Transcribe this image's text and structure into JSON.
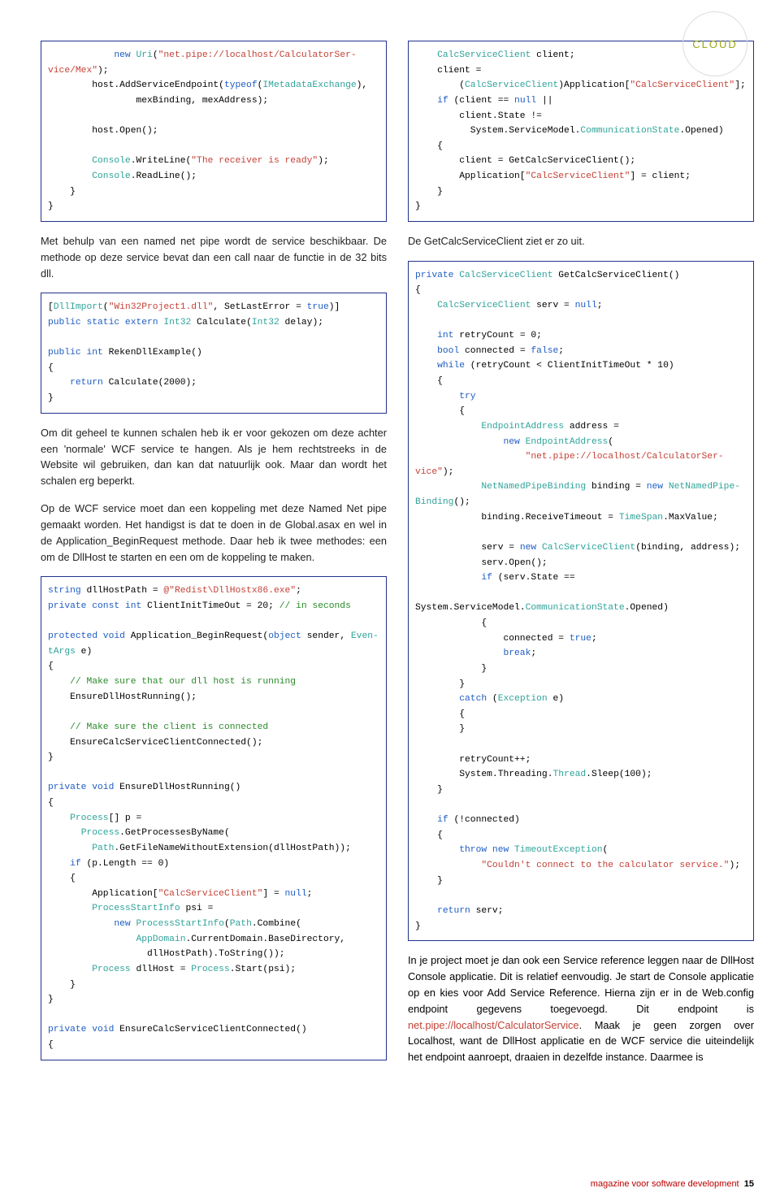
{
  "badge": "CLOUD",
  "left": {
    "code1": [
      {
        "t": "m",
        "v": "            "
      },
      {
        "t": "k",
        "v": "new"
      },
      {
        "t": "m",
        "v": " "
      },
      {
        "t": "t",
        "v": "Uri"
      },
      {
        "t": "m",
        "v": "("
      },
      {
        "t": "s",
        "v": "\"net.pipe://localhost/CalculatorSer-"
      },
      {
        "t": "br"
      },
      {
        "t": "s",
        "v": "vice/Mex\""
      },
      {
        "t": "m",
        "v": ");"
      },
      {
        "t": "br"
      },
      {
        "t": "m",
        "v": "        host.AddServiceEndpoint("
      },
      {
        "t": "k",
        "v": "typeof"
      },
      {
        "t": "m",
        "v": "("
      },
      {
        "t": "t",
        "v": "IMetadataExchange"
      },
      {
        "t": "m",
        "v": "),"
      },
      {
        "t": "br"
      },
      {
        "t": "m",
        "v": "                mexBinding, mexAddress);"
      },
      {
        "t": "br"
      },
      {
        "t": "br"
      },
      {
        "t": "m",
        "v": "        host.Open();"
      },
      {
        "t": "br"
      },
      {
        "t": "br"
      },
      {
        "t": "m",
        "v": "        "
      },
      {
        "t": "t",
        "v": "Console"
      },
      {
        "t": "m",
        "v": ".WriteLine("
      },
      {
        "t": "s",
        "v": "\"The receiver is ready\""
      },
      {
        "t": "m",
        "v": ");"
      },
      {
        "t": "br"
      },
      {
        "t": "m",
        "v": "        "
      },
      {
        "t": "t",
        "v": "Console"
      },
      {
        "t": "m",
        "v": ".ReadLine();"
      },
      {
        "t": "br"
      },
      {
        "t": "m",
        "v": "    }"
      },
      {
        "t": "br"
      },
      {
        "t": "m",
        "v": "}"
      }
    ],
    "para1": "Met behulp van een named net pipe wordt de service beschikbaar. De methode op deze service bevat dan een call naar de functie in de 32 bits dll.",
    "code2": [
      {
        "t": "m",
        "v": "["
      },
      {
        "t": "t",
        "v": "DllImport"
      },
      {
        "t": "m",
        "v": "("
      },
      {
        "t": "s",
        "v": "\"Win32Project1.dll\""
      },
      {
        "t": "m",
        "v": ", SetLastError = "
      },
      {
        "t": "k",
        "v": "true"
      },
      {
        "t": "m",
        "v": ")]"
      },
      {
        "t": "br"
      },
      {
        "t": "k",
        "v": "public static extern "
      },
      {
        "t": "t",
        "v": "Int32"
      },
      {
        "t": "m",
        "v": " Calculate("
      },
      {
        "t": "t",
        "v": "Int32"
      },
      {
        "t": "m",
        "v": " delay);"
      },
      {
        "t": "br"
      },
      {
        "t": "br"
      },
      {
        "t": "k",
        "v": "public "
      },
      {
        "t": "k",
        "v": "int"
      },
      {
        "t": "m",
        "v": " RekenDllExample()"
      },
      {
        "t": "br"
      },
      {
        "t": "m",
        "v": "{"
      },
      {
        "t": "br"
      },
      {
        "t": "m",
        "v": "    "
      },
      {
        "t": "k",
        "v": "return"
      },
      {
        "t": "m",
        "v": " Calculate(2000);"
      },
      {
        "t": "br"
      },
      {
        "t": "m",
        "v": "}"
      }
    ],
    "para2": "Om dit geheel te kunnen schalen heb ik er voor gekozen om deze achter een 'normale' WCF service te hangen. Als je hem rechtstreeks in de Website wil gebruiken, dan kan dat natuurlijk ook. Maar dan wordt het schalen erg beperkt.",
    "para3": "Op de WCF service moet dan een koppeling met deze Named Net pipe gemaakt worden. Het handigst is dat te doen in de Global.asax en wel in de Application_BeginRequest methode. Daar heb ik twee methodes: een om de DllHost te starten en een om de koppeling te maken.",
    "code3": [
      {
        "t": "k",
        "v": "string"
      },
      {
        "t": "m",
        "v": " dllHostPath = "
      },
      {
        "t": "s",
        "v": "@\"Redist\\DllHostx86.exe\""
      },
      {
        "t": "m",
        "v": ";"
      },
      {
        "t": "br"
      },
      {
        "t": "k",
        "v": "private const int"
      },
      {
        "t": "m",
        "v": " ClientInitTimeOut = 20; "
      },
      {
        "t": "c",
        "v": "// in seconds"
      },
      {
        "t": "br"
      },
      {
        "t": "br"
      },
      {
        "t": "k",
        "v": "protected void"
      },
      {
        "t": "m",
        "v": " Application_BeginRequest("
      },
      {
        "t": "k",
        "v": "object"
      },
      {
        "t": "m",
        "v": " sender, "
      },
      {
        "t": "t",
        "v": "Even-"
      },
      {
        "t": "br"
      },
      {
        "t": "t",
        "v": "tArgs"
      },
      {
        "t": "m",
        "v": " e)"
      },
      {
        "t": "br"
      },
      {
        "t": "m",
        "v": "{"
      },
      {
        "t": "br"
      },
      {
        "t": "m",
        "v": "    "
      },
      {
        "t": "c",
        "v": "// Make sure that our dll host is running"
      },
      {
        "t": "br"
      },
      {
        "t": "m",
        "v": "    EnsureDllHostRunning();"
      },
      {
        "t": "br"
      },
      {
        "t": "br"
      },
      {
        "t": "m",
        "v": "    "
      },
      {
        "t": "c",
        "v": "// Make sure the client is connected"
      },
      {
        "t": "br"
      },
      {
        "t": "m",
        "v": "    EnsureCalcServiceClientConnected();"
      },
      {
        "t": "br"
      },
      {
        "t": "m",
        "v": "}"
      },
      {
        "t": "br"
      },
      {
        "t": "br"
      },
      {
        "t": "k",
        "v": "private void"
      },
      {
        "t": "m",
        "v": " EnsureDllHostRunning()"
      },
      {
        "t": "br"
      },
      {
        "t": "m",
        "v": "{"
      },
      {
        "t": "br"
      },
      {
        "t": "m",
        "v": "    "
      },
      {
        "t": "t",
        "v": "Process"
      },
      {
        "t": "m",
        "v": "[] p ="
      },
      {
        "t": "br"
      },
      {
        "t": "m",
        "v": "      "
      },
      {
        "t": "t",
        "v": "Process"
      },
      {
        "t": "m",
        "v": ".GetProcessesByName("
      },
      {
        "t": "br"
      },
      {
        "t": "m",
        "v": "        "
      },
      {
        "t": "t",
        "v": "Path"
      },
      {
        "t": "m",
        "v": ".GetFileNameWithoutExtension(dllHostPath));"
      },
      {
        "t": "br"
      },
      {
        "t": "m",
        "v": "    "
      },
      {
        "t": "k",
        "v": "if"
      },
      {
        "t": "m",
        "v": " (p.Length == 0)"
      },
      {
        "t": "br"
      },
      {
        "t": "m",
        "v": "    {"
      },
      {
        "t": "br"
      },
      {
        "t": "m",
        "v": "        Application["
      },
      {
        "t": "s",
        "v": "\"CalcServiceClient\""
      },
      {
        "t": "m",
        "v": "] = "
      },
      {
        "t": "k",
        "v": "null"
      },
      {
        "t": "m",
        "v": ";"
      },
      {
        "t": "br"
      },
      {
        "t": "m",
        "v": "        "
      },
      {
        "t": "t",
        "v": "ProcessStartInfo"
      },
      {
        "t": "m",
        "v": " psi ="
      },
      {
        "t": "br"
      },
      {
        "t": "m",
        "v": "            "
      },
      {
        "t": "k",
        "v": "new"
      },
      {
        "t": "m",
        "v": " "
      },
      {
        "t": "t",
        "v": "ProcessStartInfo"
      },
      {
        "t": "m",
        "v": "("
      },
      {
        "t": "t",
        "v": "Path"
      },
      {
        "t": "m",
        "v": ".Combine("
      },
      {
        "t": "br"
      },
      {
        "t": "m",
        "v": "                "
      },
      {
        "t": "t",
        "v": "AppDomain"
      },
      {
        "t": "m",
        "v": ".CurrentDomain.BaseDirectory,"
      },
      {
        "t": "br"
      },
      {
        "t": "m",
        "v": "                  dllHostPath).ToString());"
      },
      {
        "t": "br"
      },
      {
        "t": "m",
        "v": "        "
      },
      {
        "t": "t",
        "v": "Process"
      },
      {
        "t": "m",
        "v": " dllHost = "
      },
      {
        "t": "t",
        "v": "Process"
      },
      {
        "t": "m",
        "v": ".Start(psi);"
      },
      {
        "t": "br"
      },
      {
        "t": "m",
        "v": "    }"
      },
      {
        "t": "br"
      },
      {
        "t": "m",
        "v": "}"
      },
      {
        "t": "br"
      },
      {
        "t": "br"
      },
      {
        "t": "k",
        "v": "private void"
      },
      {
        "t": "m",
        "v": " EnsureCalcServiceClientConnected()"
      },
      {
        "t": "br"
      },
      {
        "t": "m",
        "v": "{"
      }
    ]
  },
  "right": {
    "code1": [
      {
        "t": "m",
        "v": "    "
      },
      {
        "t": "t",
        "v": "CalcServiceClient"
      },
      {
        "t": "m",
        "v": " client;"
      },
      {
        "t": "br"
      },
      {
        "t": "m",
        "v": "    client ="
      },
      {
        "t": "br"
      },
      {
        "t": "m",
        "v": "        ("
      },
      {
        "t": "t",
        "v": "CalcServiceClient"
      },
      {
        "t": "m",
        "v": ")Application["
      },
      {
        "t": "s",
        "v": "\"CalcServiceClient\""
      },
      {
        "t": "m",
        "v": "];"
      },
      {
        "t": "br"
      },
      {
        "t": "m",
        "v": "    "
      },
      {
        "t": "k",
        "v": "if"
      },
      {
        "t": "m",
        "v": " (client == "
      },
      {
        "t": "k",
        "v": "null"
      },
      {
        "t": "m",
        "v": " ||"
      },
      {
        "t": "br"
      },
      {
        "t": "m",
        "v": "        client.State !="
      },
      {
        "t": "br"
      },
      {
        "t": "m",
        "v": "          System.ServiceModel."
      },
      {
        "t": "t",
        "v": "CommunicationState"
      },
      {
        "t": "m",
        "v": ".Opened)"
      },
      {
        "t": "br"
      },
      {
        "t": "m",
        "v": "    {"
      },
      {
        "t": "br"
      },
      {
        "t": "m",
        "v": "        client = GetCalcServiceClient();"
      },
      {
        "t": "br"
      },
      {
        "t": "m",
        "v": "        Application["
      },
      {
        "t": "s",
        "v": "\"CalcServiceClient\""
      },
      {
        "t": "m",
        "v": "] = client;"
      },
      {
        "t": "br"
      },
      {
        "t": "m",
        "v": "    }"
      },
      {
        "t": "br"
      },
      {
        "t": "m",
        "v": "}"
      }
    ],
    "para1": "De GetCalcServiceClient ziet er zo uit.",
    "code2": [
      {
        "t": "k",
        "v": "private "
      },
      {
        "t": "t",
        "v": "CalcServiceClient"
      },
      {
        "t": "m",
        "v": " GetCalcServiceClient()"
      },
      {
        "t": "br"
      },
      {
        "t": "m",
        "v": "{"
      },
      {
        "t": "br"
      },
      {
        "t": "m",
        "v": "    "
      },
      {
        "t": "t",
        "v": "CalcServiceClient"
      },
      {
        "t": "m",
        "v": " serv = "
      },
      {
        "t": "k",
        "v": "null"
      },
      {
        "t": "m",
        "v": ";"
      },
      {
        "t": "br"
      },
      {
        "t": "br"
      },
      {
        "t": "m",
        "v": "    "
      },
      {
        "t": "k",
        "v": "int"
      },
      {
        "t": "m",
        "v": " retryCount = 0;"
      },
      {
        "t": "br"
      },
      {
        "t": "m",
        "v": "    "
      },
      {
        "t": "k",
        "v": "bool"
      },
      {
        "t": "m",
        "v": " connected = "
      },
      {
        "t": "k",
        "v": "false"
      },
      {
        "t": "m",
        "v": ";"
      },
      {
        "t": "br"
      },
      {
        "t": "m",
        "v": "    "
      },
      {
        "t": "k",
        "v": "while"
      },
      {
        "t": "m",
        "v": " (retryCount < ClientInitTimeOut * 10)"
      },
      {
        "t": "br"
      },
      {
        "t": "m",
        "v": "    {"
      },
      {
        "t": "br"
      },
      {
        "t": "m",
        "v": "        "
      },
      {
        "t": "k",
        "v": "try"
      },
      {
        "t": "br"
      },
      {
        "t": "m",
        "v": "        {"
      },
      {
        "t": "br"
      },
      {
        "t": "m",
        "v": "            "
      },
      {
        "t": "t",
        "v": "EndpointAddress"
      },
      {
        "t": "m",
        "v": " address ="
      },
      {
        "t": "br"
      },
      {
        "t": "m",
        "v": "                "
      },
      {
        "t": "k",
        "v": "new"
      },
      {
        "t": "m",
        "v": " "
      },
      {
        "t": "t",
        "v": "EndpointAddress"
      },
      {
        "t": "m",
        "v": "("
      },
      {
        "t": "br"
      },
      {
        "t": "m",
        "v": "                    "
      },
      {
        "t": "s",
        "v": "\"net.pipe://localhost/CalculatorSer-"
      },
      {
        "t": "br"
      },
      {
        "t": "s",
        "v": "vice\""
      },
      {
        "t": "m",
        "v": ");"
      },
      {
        "t": "br"
      },
      {
        "t": "m",
        "v": "            "
      },
      {
        "t": "t",
        "v": "NetNamedPipeBinding"
      },
      {
        "t": "m",
        "v": " binding = "
      },
      {
        "t": "k",
        "v": "new"
      },
      {
        "t": "m",
        "v": " "
      },
      {
        "t": "t",
        "v": "NetNamedPipe-"
      },
      {
        "t": "br"
      },
      {
        "t": "t",
        "v": "Binding"
      },
      {
        "t": "m",
        "v": "();"
      },
      {
        "t": "br"
      },
      {
        "t": "m",
        "v": "            binding.ReceiveTimeout = "
      },
      {
        "t": "t",
        "v": "TimeSpan"
      },
      {
        "t": "m",
        "v": ".MaxValue;"
      },
      {
        "t": "br"
      },
      {
        "t": "br"
      },
      {
        "t": "m",
        "v": "            serv = "
      },
      {
        "t": "k",
        "v": "new"
      },
      {
        "t": "m",
        "v": " "
      },
      {
        "t": "t",
        "v": "CalcServiceClient"
      },
      {
        "t": "m",
        "v": "(binding, address);"
      },
      {
        "t": "br"
      },
      {
        "t": "m",
        "v": "            serv.Open();"
      },
      {
        "t": "br"
      },
      {
        "t": "m",
        "v": "            "
      },
      {
        "t": "k",
        "v": "if"
      },
      {
        "t": "m",
        "v": " (serv.State =="
      },
      {
        "t": "br"
      },
      {
        "t": "br"
      },
      {
        "t": "m",
        "v": "System.ServiceModel."
      },
      {
        "t": "t",
        "v": "CommunicationState"
      },
      {
        "t": "m",
        "v": ".Opened)"
      },
      {
        "t": "br"
      },
      {
        "t": "m",
        "v": "            {"
      },
      {
        "t": "br"
      },
      {
        "t": "m",
        "v": "                connected = "
      },
      {
        "t": "k",
        "v": "true"
      },
      {
        "t": "m",
        "v": ";"
      },
      {
        "t": "br"
      },
      {
        "t": "m",
        "v": "                "
      },
      {
        "t": "k",
        "v": "break"
      },
      {
        "t": "m",
        "v": ";"
      },
      {
        "t": "br"
      },
      {
        "t": "m",
        "v": "            }"
      },
      {
        "t": "br"
      },
      {
        "t": "m",
        "v": "        }"
      },
      {
        "t": "br"
      },
      {
        "t": "m",
        "v": "        "
      },
      {
        "t": "k",
        "v": "catch"
      },
      {
        "t": "m",
        "v": " ("
      },
      {
        "t": "t",
        "v": "Exception"
      },
      {
        "t": "m",
        "v": " e)"
      },
      {
        "t": "br"
      },
      {
        "t": "m",
        "v": "        {"
      },
      {
        "t": "br"
      },
      {
        "t": "m",
        "v": "        }"
      },
      {
        "t": "br"
      },
      {
        "t": "br"
      },
      {
        "t": "m",
        "v": "        retryCount++;"
      },
      {
        "t": "br"
      },
      {
        "t": "m",
        "v": "        System.Threading."
      },
      {
        "t": "t",
        "v": "Thread"
      },
      {
        "t": "m",
        "v": ".Sleep(100);"
      },
      {
        "t": "br"
      },
      {
        "t": "m",
        "v": "    }"
      },
      {
        "t": "br"
      },
      {
        "t": "br"
      },
      {
        "t": "m",
        "v": "    "
      },
      {
        "t": "k",
        "v": "if"
      },
      {
        "t": "m",
        "v": " (!connected)"
      },
      {
        "t": "br"
      },
      {
        "t": "m",
        "v": "    {"
      },
      {
        "t": "br"
      },
      {
        "t": "m",
        "v": "        "
      },
      {
        "t": "k",
        "v": "throw new"
      },
      {
        "t": "m",
        "v": " "
      },
      {
        "t": "t",
        "v": "TimeoutException"
      },
      {
        "t": "m",
        "v": "("
      },
      {
        "t": "br"
      },
      {
        "t": "m",
        "v": "            "
      },
      {
        "t": "s",
        "v": "\"Couldn't connect to the calculator service.\""
      },
      {
        "t": "m",
        "v": ");"
      },
      {
        "t": "br"
      },
      {
        "t": "m",
        "v": "    }"
      },
      {
        "t": "br"
      },
      {
        "t": "br"
      },
      {
        "t": "m",
        "v": "    "
      },
      {
        "t": "k",
        "v": "return"
      },
      {
        "t": "m",
        "v": " serv;"
      },
      {
        "t": "br"
      },
      {
        "t": "m",
        "v": "}"
      }
    ],
    "para2_tokens": [
      {
        "t": "m",
        "v": "In je project moet je dan ook een Service reference leggen naar de DllHost Console applicatie. Dit is relatief eenvoudig. Je start de Console applicatie op en kies voor Add Service Reference. Hierna zijn er in de Web.config endpoint gegevens toegevoegd. Dit endpoint is "
      },
      {
        "t": "s",
        "v": "net.pipe://localhost/CalculatorService"
      },
      {
        "t": "m",
        "v": ". Maak je geen zorgen over Localhost, want de DllHost applicatie en de WCF service die uiteindelijk het endpoint aanroept, draaien in dezelfde instance. Daarmee is"
      }
    ]
  },
  "footer": {
    "text1": "magazine voor software development",
    "page": "15"
  }
}
